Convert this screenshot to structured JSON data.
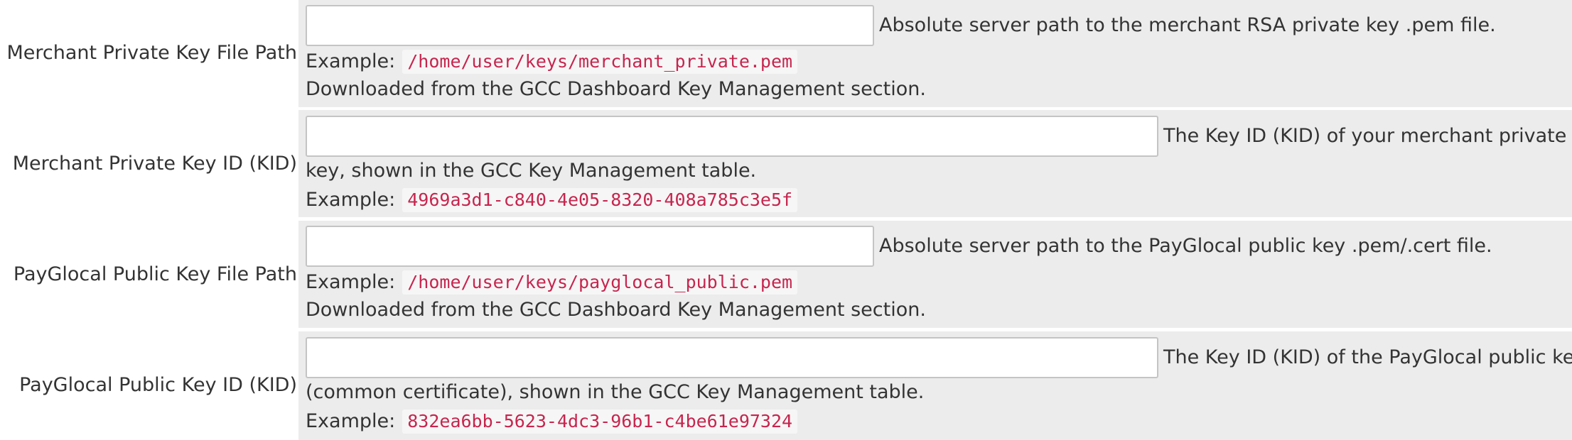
{
  "fields": [
    {
      "label": "Merchant Private Key File Path",
      "input_value": "",
      "description_line1": "Absolute server path to the merchant RSA private key .pem file.",
      "example_label": "Example:",
      "example_value": "/home/user/keys/merchant_private.pem",
      "note": "Downloaded from the GCC Dashboard Key Management section."
    },
    {
      "label": "Merchant Private Key ID (KID)",
      "input_value": "",
      "description_line1": "The Key ID (KID) of your merchant private",
      "description_line2": "key, shown in the GCC Key Management table.",
      "example_label": "Example:",
      "example_value": "4969a3d1-c840-4e05-8320-408a785c3e5f"
    },
    {
      "label": "PayGlocal Public Key File Path",
      "input_value": "",
      "description_line1": "Absolute server path to the PayGlocal public key .pem/.cert file.",
      "example_label": "Example:",
      "example_value": "/home/user/keys/payglocal_public.pem",
      "note": "Downloaded from the GCC Dashboard Key Management section."
    },
    {
      "label": "PayGlocal Public Key ID (KID)",
      "input_value": "",
      "description_line1": "The Key ID (KID) of the PayGlocal public key",
      "description_line2": "(common certificate), shown in the GCC Key Management table.",
      "example_label": "Example:",
      "example_value": "832ea6bb-5623-4dc3-96b1-c4be61e97324"
    }
  ]
}
